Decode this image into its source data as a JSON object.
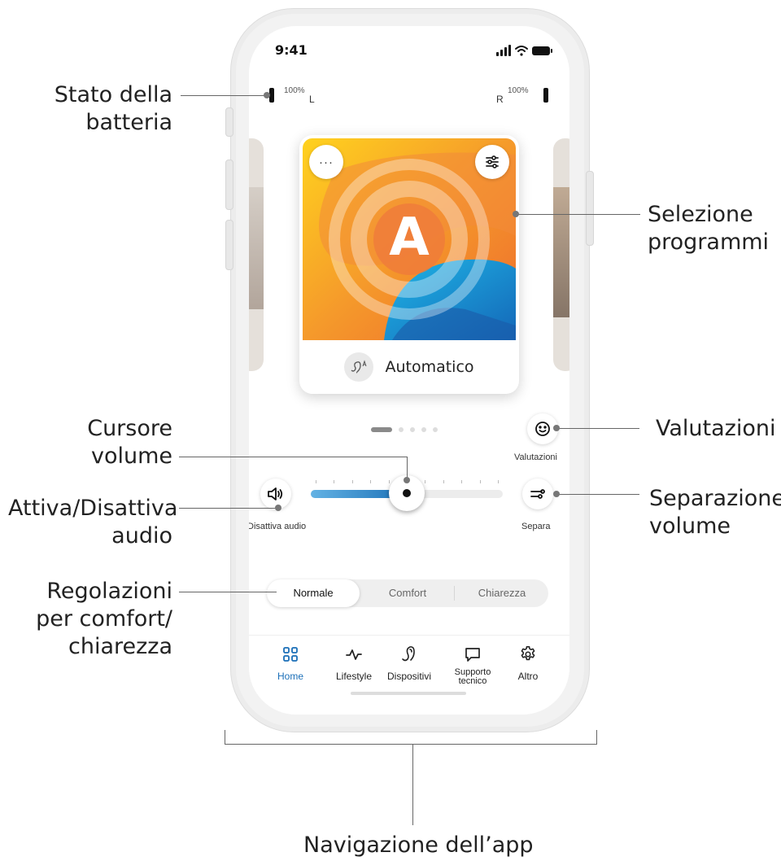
{
  "callouts": {
    "battery": [
      "Stato della",
      "batteria"
    ],
    "programs": [
      "Selezione",
      "programmi"
    ],
    "ratings": "Valutazioni",
    "volume_cursor": [
      "Cursore",
      "volume"
    ],
    "mute": [
      "Attiva/Disattiva",
      "audio"
    ],
    "split_volume": [
      "Separazione",
      "volume"
    ],
    "comfort_clarity": [
      "Regolazioni",
      "per comfort/",
      "chiarezza"
    ],
    "app_nav": "Navigazione dell’app"
  },
  "status_bar": {
    "time": "9:41"
  },
  "battery": {
    "left": {
      "percent": "100%",
      "side": "L"
    },
    "right": {
      "percent": "100%",
      "side": "R"
    }
  },
  "program": {
    "initial": "A",
    "name": "Automatico",
    "menu_glyph": "···",
    "pager_total": 5,
    "pager_active": 1
  },
  "controls": {
    "ratings_label": "Valutazioni",
    "mute_label": "Disattiva audio",
    "split_label": "Separa",
    "volume_level": 0.5
  },
  "sound_modes": {
    "options": [
      "Normale",
      "Comfort",
      "Chiarezza"
    ],
    "selected": "Normale"
  },
  "nav": {
    "items": [
      {
        "label": "Home",
        "icon": "grid-icon",
        "active": true
      },
      {
        "label": "Lifestyle",
        "icon": "activity-icon",
        "active": false
      },
      {
        "label": "Dispositivi",
        "icon": "hearing-aid-icon",
        "active": false
      },
      {
        "label": "Supporto tecnico",
        "icon": "chat-icon",
        "active": false
      },
      {
        "label": "Altro",
        "icon": "gear-icon",
        "active": false
      }
    ]
  },
  "colors": {
    "accent": "#1b6fb8",
    "slider_fill_start": "#63b2e4",
    "slider_fill_end": "#1d72b8"
  }
}
